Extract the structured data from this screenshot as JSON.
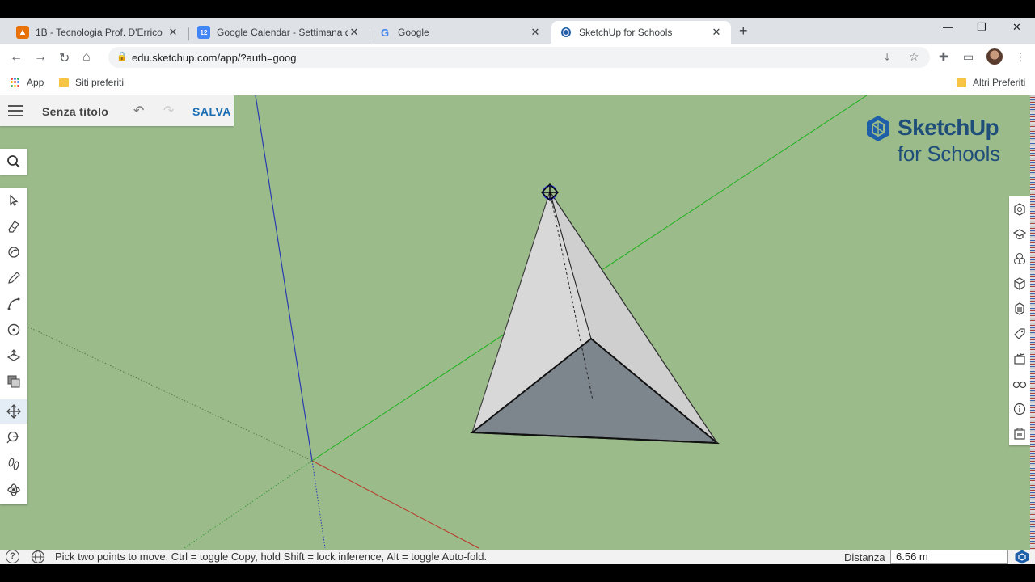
{
  "browser": {
    "tabs": [
      {
        "title": "1B - Tecnologia Prof. D'Errico",
        "favicon_color": "#e8710a",
        "favicon_glyph": "▲"
      },
      {
        "title": "Google Calendar - Settimana del",
        "favicon_color": "#4285f4",
        "favicon_glyph": "12"
      },
      {
        "title": "Google",
        "favicon_color": "#ffffff",
        "favicon_glyph": "G"
      },
      {
        "title": "SketchUp for Schools",
        "favicon_color": "#1f5fa8",
        "favicon_glyph": "S",
        "active": true
      }
    ],
    "new_tab_glyph": "+",
    "close_glyph": "✕",
    "window_controls": {
      "minimize": "—",
      "restore": "❐",
      "close": "✕"
    },
    "url": "edu.sketchup.com/app/?auth=goog",
    "bookmarks": {
      "apps_label": "App",
      "siti_label": "Siti preferiti",
      "altri_label": "Altri Preferiti"
    }
  },
  "app": {
    "doc_title": "Senza titolo",
    "save_label": "SALVA",
    "undo_glyph": "↶",
    "redo_glyph": "↷",
    "logo_line1": "SketchUp",
    "logo_line2": "for Schools",
    "brand_color": "#1f4e79",
    "accent_color": "#1a6db3",
    "viewport_bg": "#9bbb8b",
    "left_tools": [
      "select-tool",
      "eraser-tool",
      "paint-bucket-tool",
      "pencil-tool",
      "arc-tool",
      "circle-tool",
      "push-pull-tool",
      "offset-tool",
      "move-tool",
      "rotate-tool",
      "tape-measure-tool",
      "orbit-tool"
    ],
    "selected_tool": "move-tool",
    "right_panels": [
      "entity-info-icon",
      "instructor-icon",
      "components-icon",
      "materials-icon",
      "styles-icon",
      "tags-icon",
      "scenes-icon",
      "display-icon",
      "model-info-icon",
      "outliner-icon"
    ]
  },
  "status": {
    "message": "Pick two points to move. Ctrl = toggle Copy, hold Shift = lock inference, Alt = toggle Auto-fold.",
    "distance_label": "Distanza",
    "distance_value": "6.56 m",
    "help_glyph": "?"
  }
}
